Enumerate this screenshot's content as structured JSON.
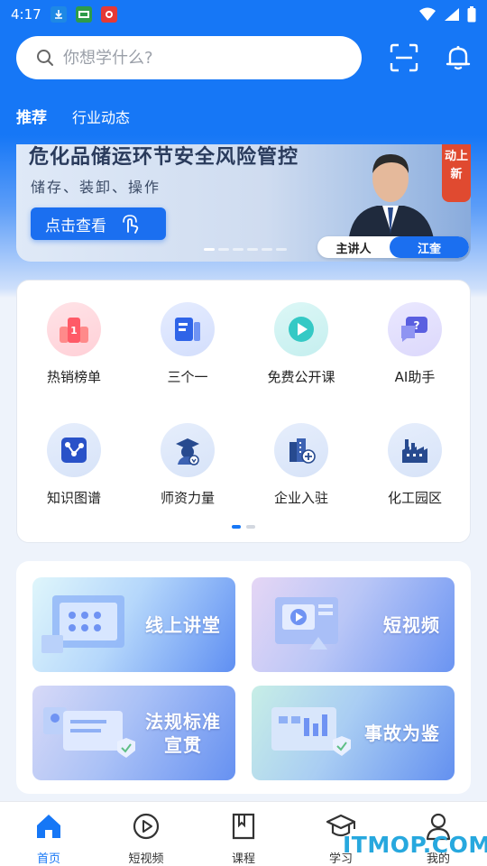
{
  "status_bar": {
    "time": "4:17"
  },
  "search": {
    "placeholder": "你想学什么?"
  },
  "tabs": [
    {
      "label": "推荐",
      "active": true
    },
    {
      "label": "行业动态",
      "active": false
    }
  ],
  "banner": {
    "title": "危化品储运环节安全风险管控",
    "subtitle": "储存、装卸、操作",
    "cta": "点击查看",
    "tag": "动上新",
    "speaker_label": "主讲人",
    "speaker_name": "江奎",
    "dots": 6,
    "active_dot": 0
  },
  "grid": {
    "items": [
      {
        "label": "热销榜单",
        "icon": "ranking-icon"
      },
      {
        "label": "三个一",
        "icon": "document-icon"
      },
      {
        "label": "免费公开课",
        "icon": "play-icon"
      },
      {
        "label": "AI助手",
        "icon": "ai-chat-icon"
      },
      {
        "label": "知识图谱",
        "icon": "knowledge-graph-icon"
      },
      {
        "label": "师资力量",
        "icon": "teacher-icon"
      },
      {
        "label": "企业入驻",
        "icon": "enterprise-icon"
      },
      {
        "label": "化工园区",
        "icon": "factory-icon"
      }
    ],
    "pages": 2,
    "active_page": 0
  },
  "features": [
    {
      "label": "线上讲堂"
    },
    {
      "label": "短视频"
    },
    {
      "label": "法规标准\n宣贯"
    },
    {
      "label": "事故为鉴"
    }
  ],
  "bottom_nav": [
    {
      "label": "首页",
      "active": true
    },
    {
      "label": "短视频",
      "active": false
    },
    {
      "label": "课程",
      "active": false
    },
    {
      "label": "学习",
      "active": false
    },
    {
      "label": "我的",
      "active": false
    }
  ],
  "watermark": "ITMOP.COM",
  "colors": {
    "primary": "#1677f6",
    "banner_button": "#1b6ff0",
    "tag_red": "#e04a30"
  }
}
